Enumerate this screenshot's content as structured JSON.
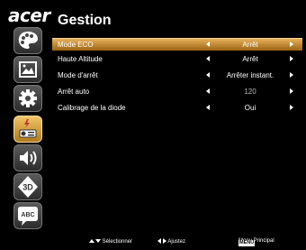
{
  "brand": {
    "logo_text": "acer"
  },
  "header": {
    "title": "Gestion"
  },
  "sidebar": {
    "items": [
      {
        "icon": "palette-icon",
        "active": false
      },
      {
        "icon": "image-icon",
        "active": false
      },
      {
        "icon": "gear-icon",
        "active": false
      },
      {
        "icon": "management-icon",
        "active": true
      },
      {
        "icon": "speaker-icon",
        "active": false
      },
      {
        "icon": "3d-icon",
        "active": false,
        "text": "3D"
      },
      {
        "icon": "language-icon",
        "active": false,
        "text": "ABC"
      }
    ]
  },
  "menu": {
    "rows": [
      {
        "label": "Mode ECO",
        "value": "Arrêt",
        "selected": true,
        "dimmed": false
      },
      {
        "label": "Haute Altitude",
        "value": "Arrêt",
        "selected": false,
        "dimmed": false
      },
      {
        "label": "Mode d'arrêt",
        "value": "Arrêter instant.",
        "selected": false,
        "dimmed": false
      },
      {
        "label": "Arrêt auto",
        "value": "120",
        "selected": false,
        "dimmed": true
      },
      {
        "label": "Calibrage de la diode",
        "value": "Oui",
        "selected": false,
        "dimmed": false
      }
    ]
  },
  "footer": {
    "select_label": "Sélectionner",
    "adjust_label": "Ajustez",
    "menu_key": "MENU",
    "main_menu_label": "Menu Principal"
  },
  "colors": {
    "accent": "#d9962c",
    "background": "#000000"
  }
}
